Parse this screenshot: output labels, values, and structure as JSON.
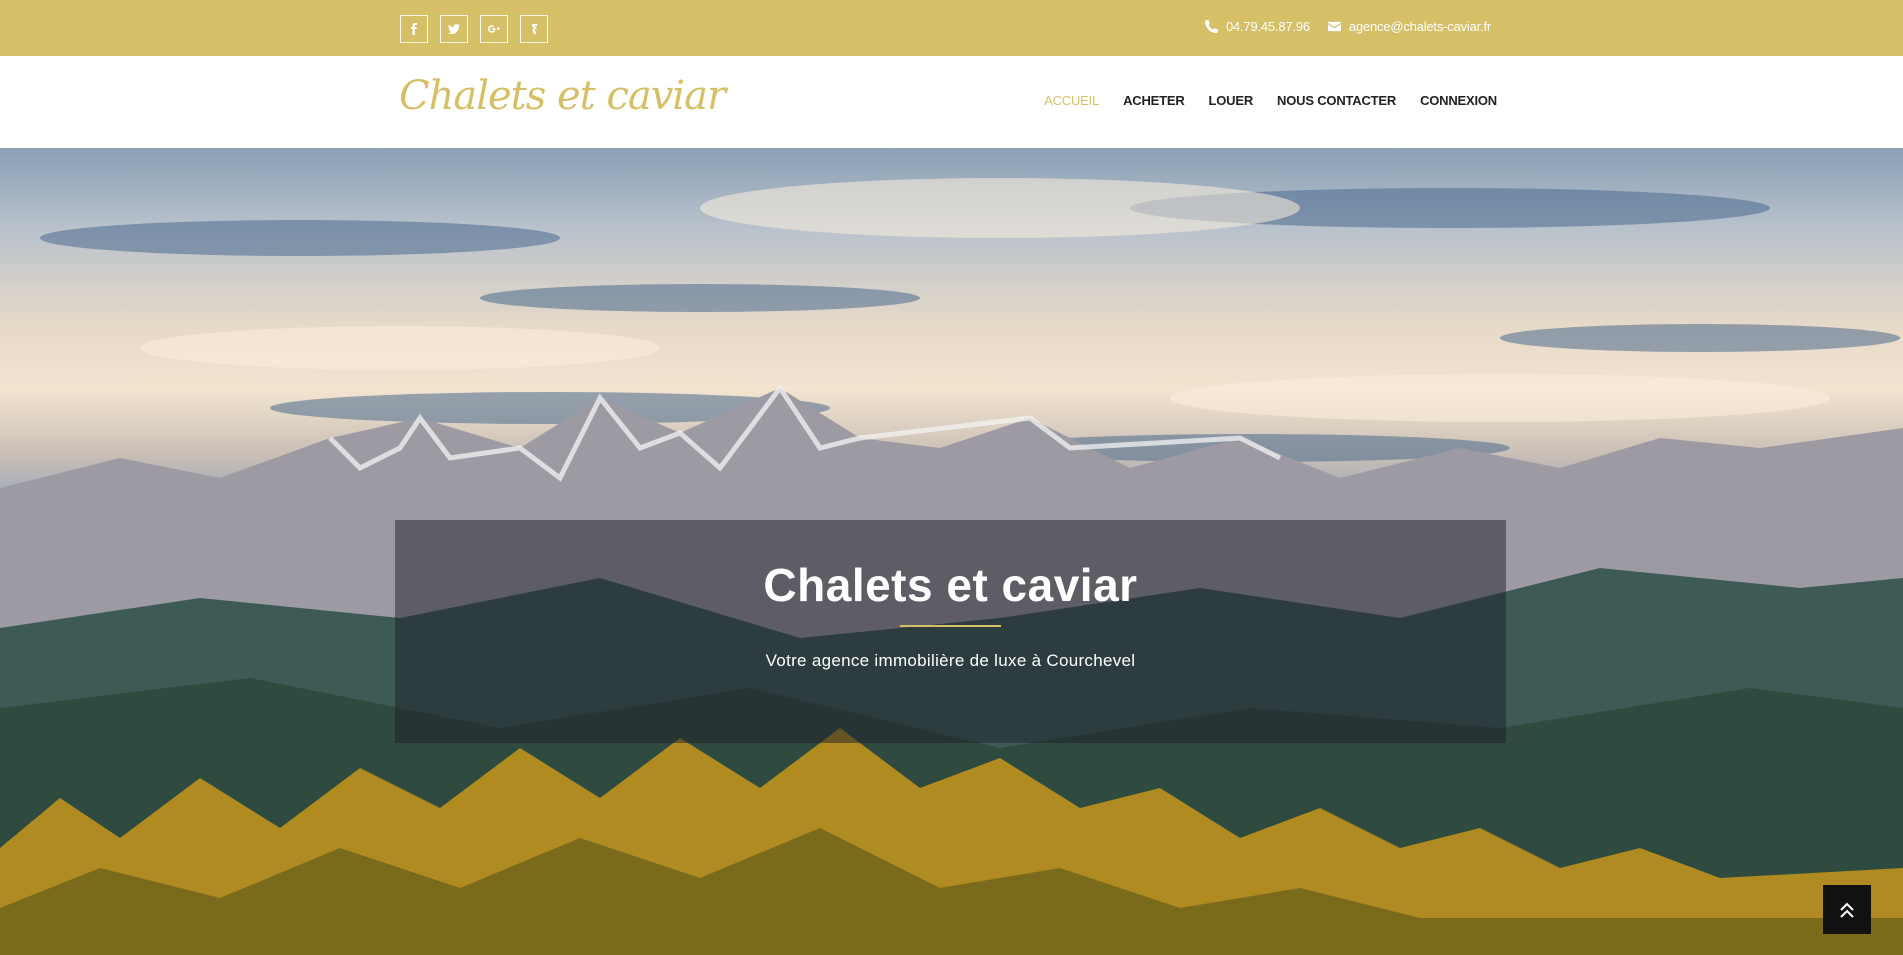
{
  "topbar": {
    "social": [
      {
        "icon": "facebook-icon",
        "glyph": "f"
      },
      {
        "icon": "twitter-icon"
      },
      {
        "icon": "google-plus-icon"
      },
      {
        "icon": "tripadvisor-icon"
      }
    ],
    "phone": "04.79.45.87.96",
    "email": "agence@chalets-caviar.fr"
  },
  "navbar": {
    "logo_text": "Chalets et caviar",
    "menu": [
      "ACCUEIL",
      "ACHETER",
      "LOUER",
      "NOUS CONTACTER",
      "CONNEXION"
    ],
    "active_index": 0
  },
  "hero": {
    "title": "Chalets et caviar",
    "subtitle": "Votre agence immobilière de luxe à Courchevel"
  },
  "colors": {
    "accent": "#d5c067",
    "nav_text": "#222222",
    "overlay": "rgba(30,30,40,0.5)",
    "backtop": "#111111"
  },
  "backtop_icon": "double-chevron-up-icon"
}
